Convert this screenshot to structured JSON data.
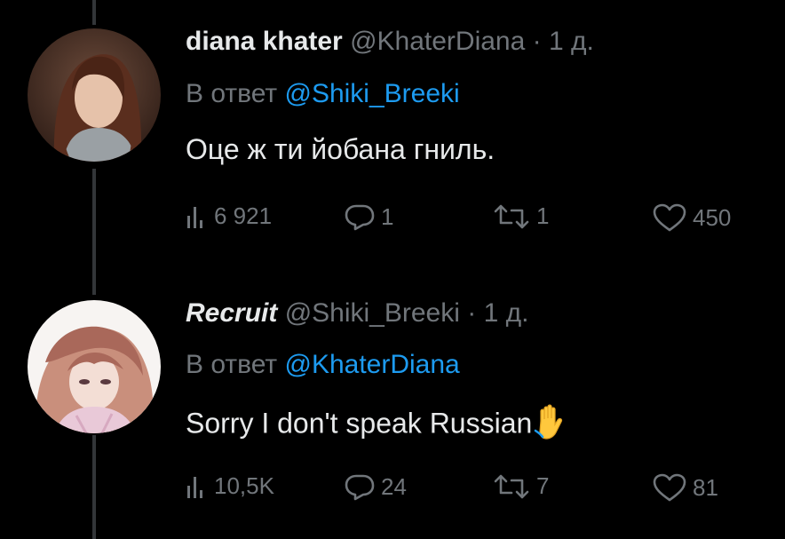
{
  "tweets": [
    {
      "display_name": "diana khater",
      "handle": "@KhaterDiana",
      "time": "· 1 д.",
      "reply_prefix": "В ответ",
      "reply_to": "@Shiki_Breeki",
      "text": "Оце ж ти йобана гниль.",
      "views": "6 921",
      "replies": "1",
      "retweets": "1",
      "likes": "450",
      "avatar": "woman-photo-avatar"
    },
    {
      "display_name": "Recruit",
      "handle": "@Shiki_Breeki",
      "time": "· 1 д.",
      "reply_prefix": "В ответ",
      "reply_to": "@KhaterDiana",
      "text": "Sorry I don't speak Russian",
      "emoji": "raised-hand-emoji",
      "views": "10,5K",
      "replies": "24",
      "retweets": "7",
      "likes": "81",
      "avatar": "anime-girl-avatar"
    }
  ],
  "colors": {
    "background": "#000000",
    "text": "#e7e9ea",
    "muted": "#71767b",
    "link": "#1d9bf0",
    "thread_line": "#333639"
  }
}
